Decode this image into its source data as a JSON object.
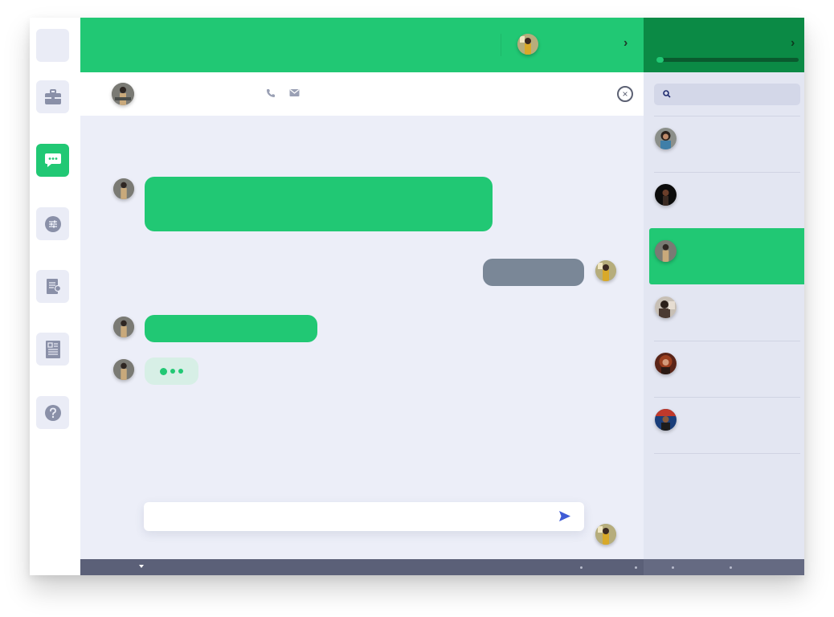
{
  "rail": {
    "items": [
      {
        "name": "blank-nav-item",
        "icon": "blank"
      },
      {
        "name": "briefcase-nav-item",
        "icon": "briefcase-icon"
      },
      {
        "name": "chat-nav-item",
        "icon": "chat-bubble-icon",
        "active": true
      },
      {
        "name": "settings-nav-item",
        "icon": "sliders-icon"
      },
      {
        "name": "document-nav-item",
        "icon": "document-icon"
      },
      {
        "name": "contacts-nav-item",
        "icon": "contact-card-icon"
      },
      {
        "name": "help-nav-item",
        "icon": "help-icon"
      }
    ]
  },
  "header": {
    "icons": [
      "phone-icon",
      "mail-icon",
      "close-icon"
    ],
    "close_label": "×"
  },
  "messages": [
    {
      "side": "incoming",
      "kind": "text"
    },
    {
      "side": "outgoing",
      "kind": "text"
    },
    {
      "side": "incoming",
      "kind": "text"
    },
    {
      "side": "incoming",
      "kind": "typing"
    }
  ],
  "composer": {
    "placeholder": "",
    "send_icon": "send-icon"
  },
  "search": {
    "placeholder": "",
    "icon": "search-icon"
  },
  "contacts": [
    {
      "avatar": "avatar-1",
      "active": false
    },
    {
      "avatar": "avatar-2",
      "active": false
    },
    {
      "avatar": "avatar-3",
      "active": true
    },
    {
      "avatar": "avatar-4",
      "active": false
    },
    {
      "avatar": "avatar-5",
      "active": false
    },
    {
      "avatar": "avatar-6",
      "active": false
    }
  ],
  "progress": {
    "fraction": 0.05
  },
  "colors": {
    "accent": "#21c874",
    "accent_dark": "#0b8a45",
    "chat_bg": "#eceef8",
    "panel_bg": "#e3e6f2",
    "outgoing_bubble": "#7a8797",
    "footer": "#5b6078"
  }
}
